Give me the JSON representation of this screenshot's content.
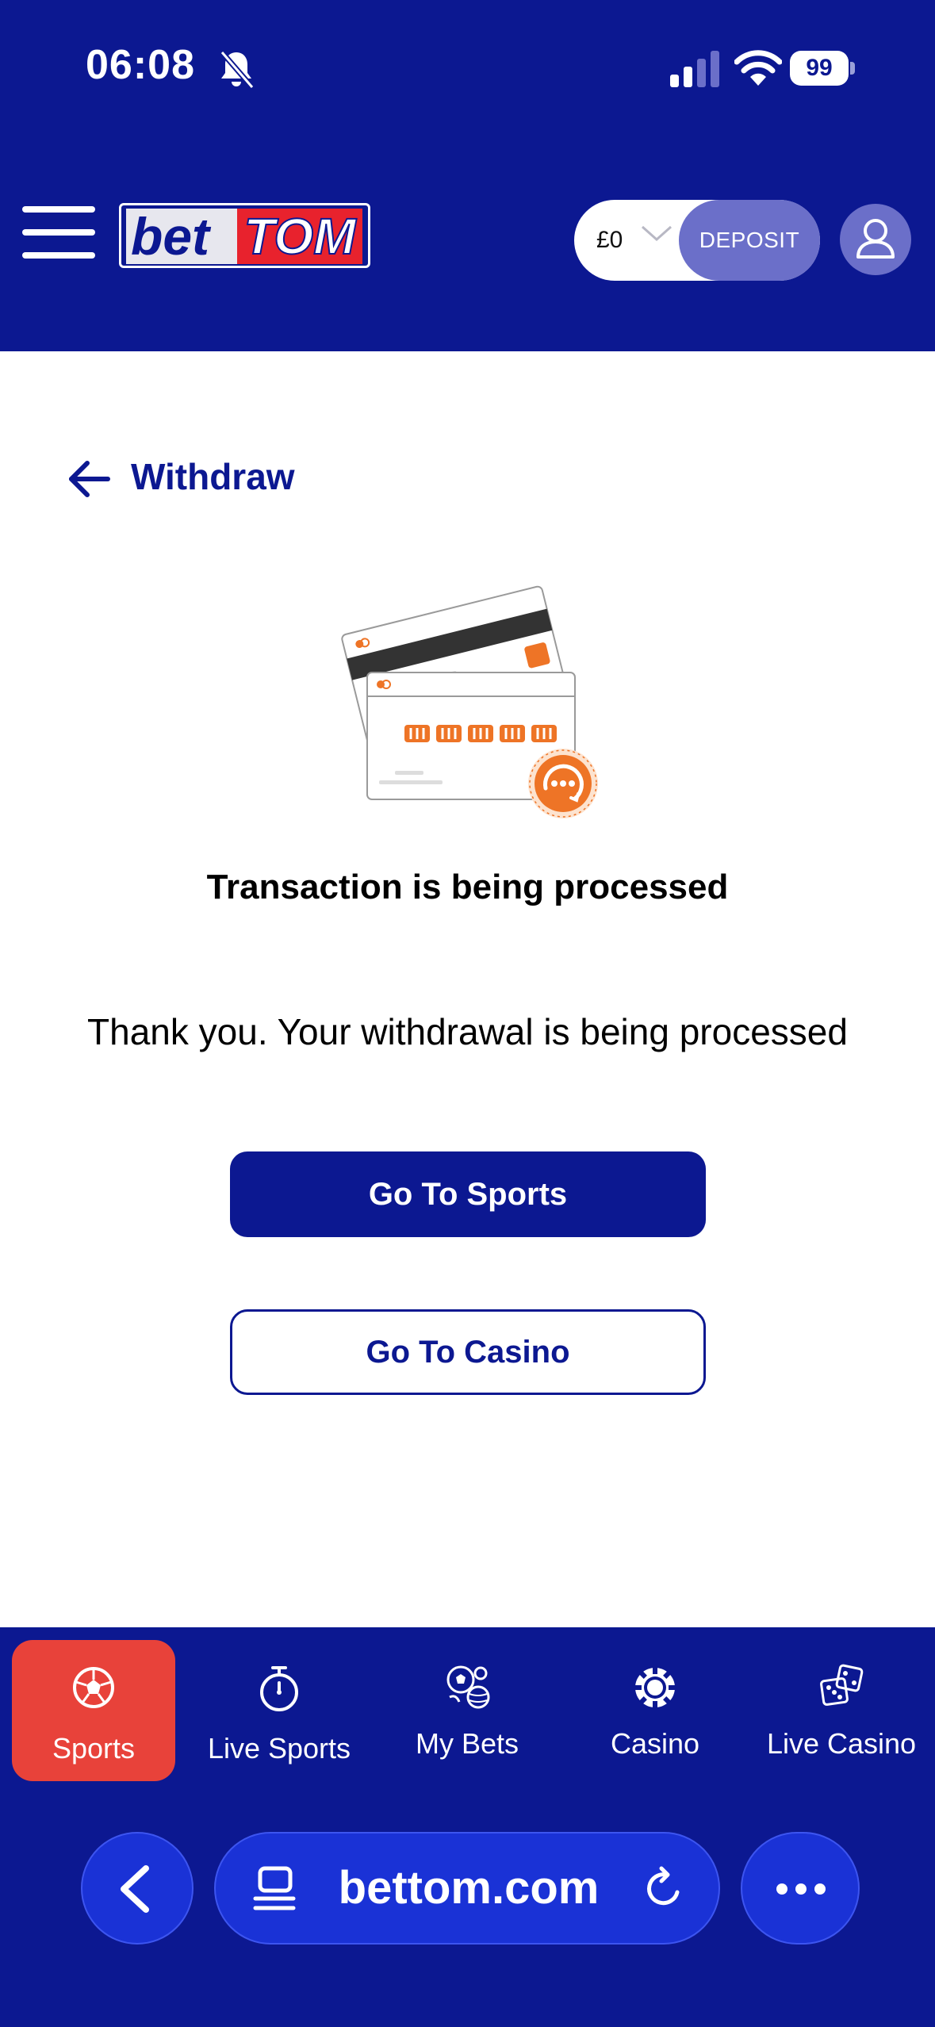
{
  "status_bar": {
    "time": "06:08",
    "battery": "99",
    "icons": [
      "bell-slash-icon",
      "signal-icon",
      "wifi-icon",
      "battery-icon"
    ]
  },
  "header": {
    "logo_bet": "bet",
    "logo_tom": "TOM",
    "balance": "£0",
    "deposit_label": "DEPOSIT",
    "icons": [
      "hamburger-menu-icon",
      "chevron-down-icon",
      "user-icon"
    ]
  },
  "page": {
    "title": "Withdraw",
    "status_title": "Transaction is being processed",
    "status_message": "Thank you. Your withdrawal is being processed",
    "primary_button": "Go To Sports",
    "secondary_button": "Go To Casino"
  },
  "bottom_nav": {
    "items": [
      {
        "label": "Sports",
        "icon": "soccer-ball-icon",
        "active": true
      },
      {
        "label": "Live Sports",
        "icon": "stopwatch-icon",
        "active": false
      },
      {
        "label": "My Bets",
        "icon": "sports-balls-icon",
        "active": false
      },
      {
        "label": "Casino",
        "icon": "casino-chip-icon",
        "active": false
      },
      {
        "label": "Live Casino",
        "icon": "dice-icon",
        "active": false
      }
    ]
  },
  "browser": {
    "url": "bettom.com",
    "icons": [
      "back-chevron-icon",
      "tabs-icon",
      "reload-icon",
      "more-icon"
    ]
  },
  "colors": {
    "brand_blue": "#0c1891",
    "active_red": "#e8423a",
    "accent_orange": "#ee7426",
    "deposit_purple": "#6b6fc9"
  }
}
